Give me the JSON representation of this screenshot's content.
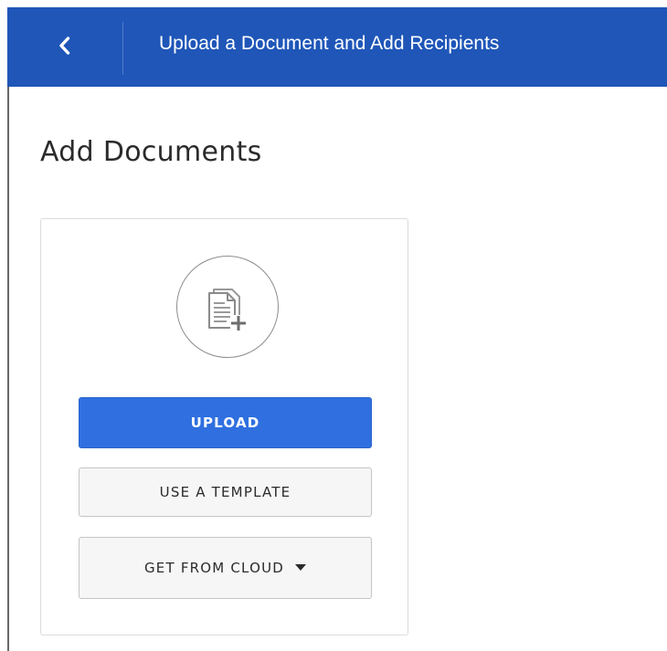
{
  "header": {
    "title": "Upload a Document and Add Recipients",
    "background_color": "#1f56b8",
    "back_icon": "chevron-left-icon"
  },
  "page": {
    "title": "Add Documents"
  },
  "card": {
    "document_icon": "document-add-icon",
    "upload_label": "UPLOAD",
    "upload_color": "#2f6fe0",
    "template_label": "USE A TEMPLATE",
    "cloud_label": "GET FROM CLOUD",
    "cloud_caret_icon": "caret-down-icon"
  }
}
